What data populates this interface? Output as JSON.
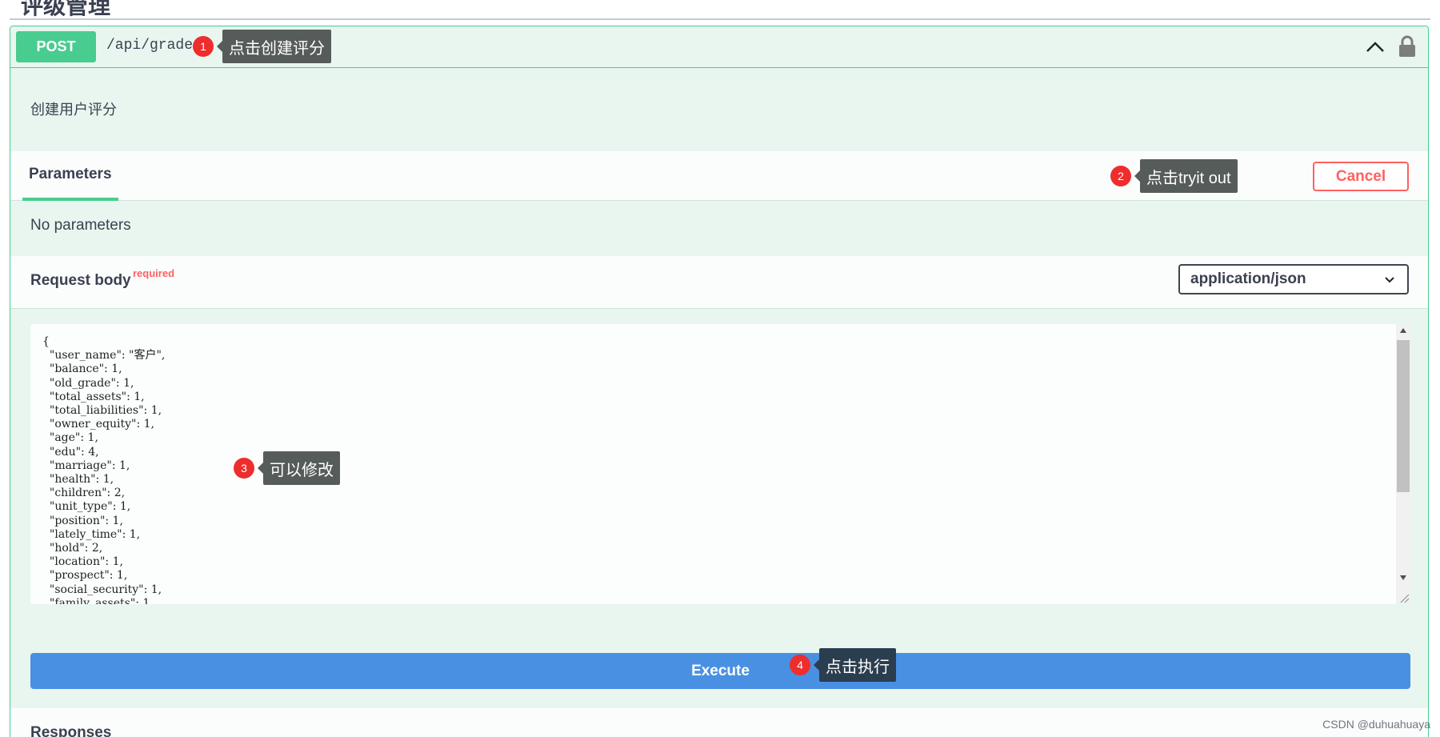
{
  "section_title": "评级管理",
  "operation": {
    "method": "POST",
    "path": "/api/grade",
    "description": "创建用户评分"
  },
  "parameters": {
    "tab_label": "Parameters",
    "cancel_label": "Cancel",
    "empty_text": "No parameters"
  },
  "request_body": {
    "label": "Request body",
    "required_label": "required",
    "content_type": "application/json",
    "json_text": "{\n  \"user_name\": \"客户\",\n  \"balance\": 1,\n  \"old_grade\": 1,\n  \"total_assets\": 1,\n  \"total_liabilities\": 1,\n  \"owner_equity\": 1,\n  \"age\": 1,\n  \"edu\": 4,\n  \"marriage\": 1,\n  \"health\": 1,\n  \"children\": 2,\n  \"unit_type\": 1,\n  \"position\": 1,\n  \"lately_time\": 1,\n  \"hold\": 2,\n  \"location\": 1,\n  \"prospect\": 1,\n  \"social_security\": 1,\n  \"family_assets\": 1"
  },
  "execute_label": "Execute",
  "responses_label": "Responses",
  "annotations": [
    {
      "number": "1",
      "text": "点击创建评分"
    },
    {
      "number": "2",
      "text": "点击tryit out"
    },
    {
      "number": "3",
      "text": "可以修改"
    },
    {
      "number": "4",
      "text": "点击执行"
    }
  ],
  "watermark": "CSDN @duhuahuaya",
  "colors": {
    "post_green": "#49cc90",
    "opblock_bg": "#e8f6ef",
    "cancel_red": "#ff6060",
    "execute_blue": "#4990e2",
    "badge_red": "#ee2d2d",
    "tooltip_gray": "#565c5a",
    "tooltip_dark": "#2b3e50"
  },
  "icons": {
    "collapse": "chevron-up-icon",
    "auth": "lock-icon",
    "content_type_dropdown": "chevron-down-icon"
  }
}
